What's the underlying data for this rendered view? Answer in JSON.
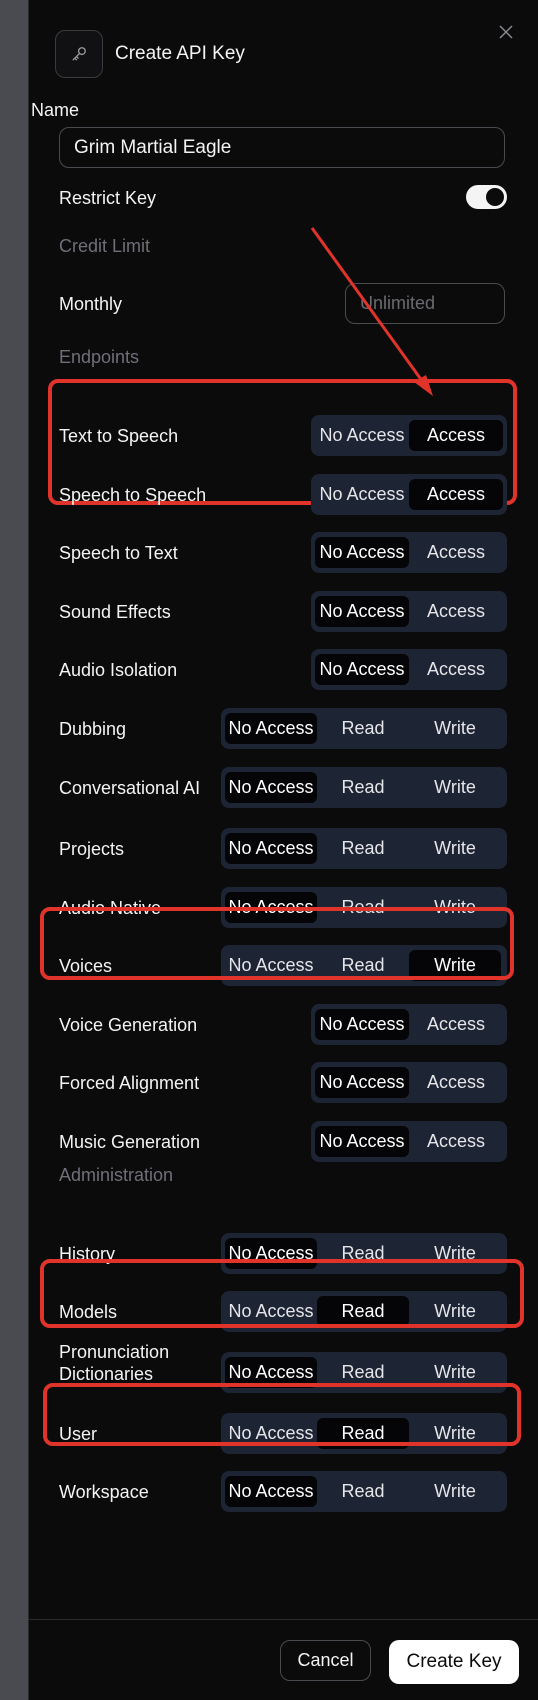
{
  "dialog": {
    "title": "Create API Key",
    "icon": "key-icon",
    "close_icon": "close-icon"
  },
  "name": {
    "label": "Name",
    "value": "Grim Martial Eagle"
  },
  "restrict": {
    "label": "Restrict Key",
    "enabled": true
  },
  "credit_limit": {
    "section": "Credit Limit",
    "monthly_label": "Monthly",
    "placeholder": "Unlimited"
  },
  "endpoints": {
    "section": "Endpoints",
    "rows": [
      {
        "label": "Text to Speech",
        "options": [
          "No Access",
          "Access"
        ],
        "selected": "Access",
        "highlighted": true
      },
      {
        "label": "Speech to Speech",
        "options": [
          "No Access",
          "Access"
        ],
        "selected": "Access",
        "highlighted": true
      },
      {
        "label": "Speech to Text",
        "options": [
          "No Access",
          "Access"
        ],
        "selected": "No Access"
      },
      {
        "label": "Sound Effects",
        "options": [
          "No Access",
          "Access"
        ],
        "selected": "No Access"
      },
      {
        "label": "Audio Isolation",
        "options": [
          "No Access",
          "Access"
        ],
        "selected": "No Access"
      },
      {
        "label": "Dubbing",
        "options": [
          "No Access",
          "Read",
          "Write"
        ],
        "selected": "No Access"
      },
      {
        "label": "Conversational AI",
        "options": [
          "No Access",
          "Read",
          "Write"
        ],
        "selected": "No Access"
      },
      {
        "label": "Projects",
        "options": [
          "No Access",
          "Read",
          "Write"
        ],
        "selected": "No Access"
      },
      {
        "label": "Audio Native",
        "options": [
          "No Access",
          "Read",
          "Write"
        ],
        "selected": "No Access"
      },
      {
        "label": "Voices",
        "options": [
          "No Access",
          "Read",
          "Write"
        ],
        "selected": "Write",
        "highlighted": true
      },
      {
        "label": "Voice Generation",
        "options": [
          "No Access",
          "Access"
        ],
        "selected": "No Access"
      },
      {
        "label": "Forced Alignment",
        "options": [
          "No Access",
          "Access"
        ],
        "selected": "No Access"
      },
      {
        "label": "Music Generation",
        "options": [
          "No Access",
          "Access"
        ],
        "selected": "No Access"
      }
    ]
  },
  "administration": {
    "section": "Administration",
    "rows": [
      {
        "label": "History",
        "options": [
          "No Access",
          "Read",
          "Write"
        ],
        "selected": "No Access"
      },
      {
        "label": "Models",
        "options": [
          "No Access",
          "Read",
          "Write"
        ],
        "selected": "Read",
        "highlighted": true
      },
      {
        "label": "Pronunciation Dictionaries",
        "options": [
          "No Access",
          "Read",
          "Write"
        ],
        "selected": "No Access"
      },
      {
        "label": "User",
        "options": [
          "No Access",
          "Read",
          "Write"
        ],
        "selected": "Read",
        "highlighted": true
      },
      {
        "label": "Workspace",
        "options": [
          "No Access",
          "Read",
          "Write"
        ],
        "selected": "No Access"
      }
    ]
  },
  "footer": {
    "cancel_label": "Cancel",
    "create_label": "Create Key"
  },
  "colors": {
    "highlight": "#e0342b",
    "segment_bg": "#1d2433",
    "panel_bg": "#0b0b0c"
  }
}
